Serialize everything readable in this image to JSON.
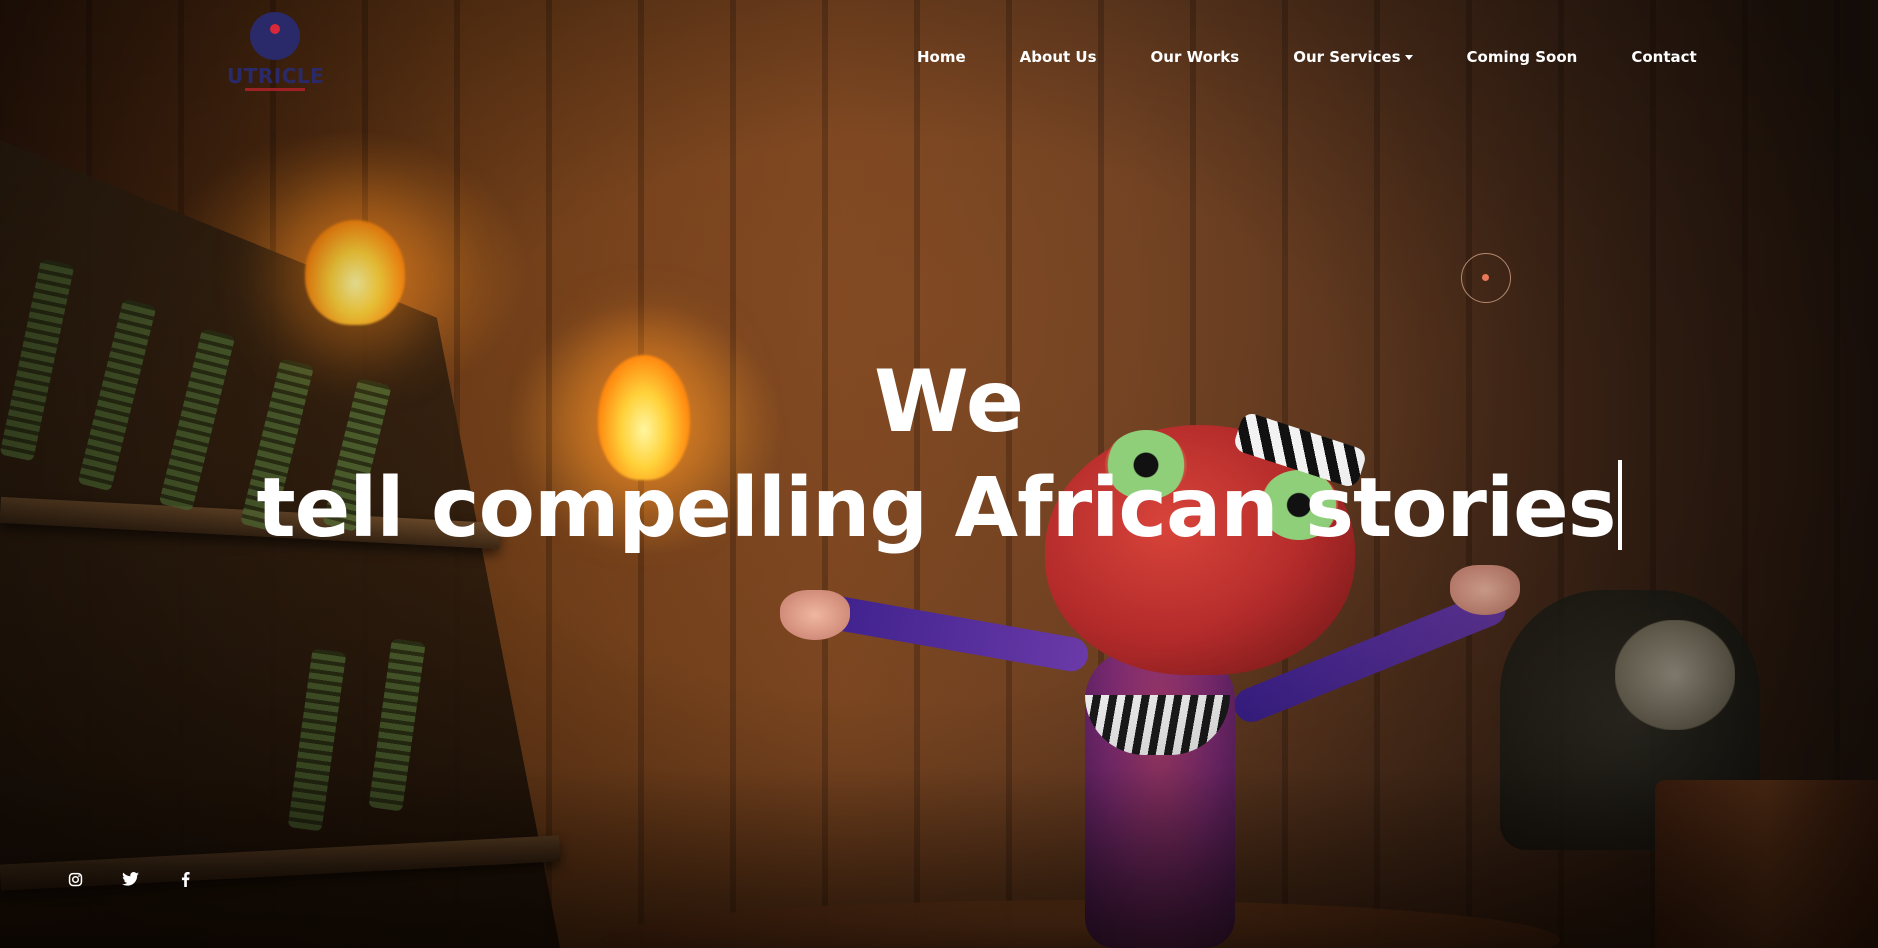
{
  "logo": {
    "text": "UTRICLE",
    "colors": {
      "mark": "#2a2a6a",
      "accent": "#d8283a"
    }
  },
  "nav": {
    "items": [
      {
        "label": "Home"
      },
      {
        "label": "About Us"
      },
      {
        "label": "Our Works"
      },
      {
        "label": "Our Services",
        "has_dropdown": true
      },
      {
        "label": "Coming Soon"
      },
      {
        "label": "Contact"
      }
    ]
  },
  "hero": {
    "line1": "We",
    "line2": "tell compelling African stories"
  },
  "socials": [
    {
      "icon": "instagram-icon"
    },
    {
      "icon": "twitter-icon"
    },
    {
      "icon": "facebook-icon"
    }
  ],
  "colors": {
    "text": "#ffffff",
    "cursor_accent": "#e8785a"
  }
}
